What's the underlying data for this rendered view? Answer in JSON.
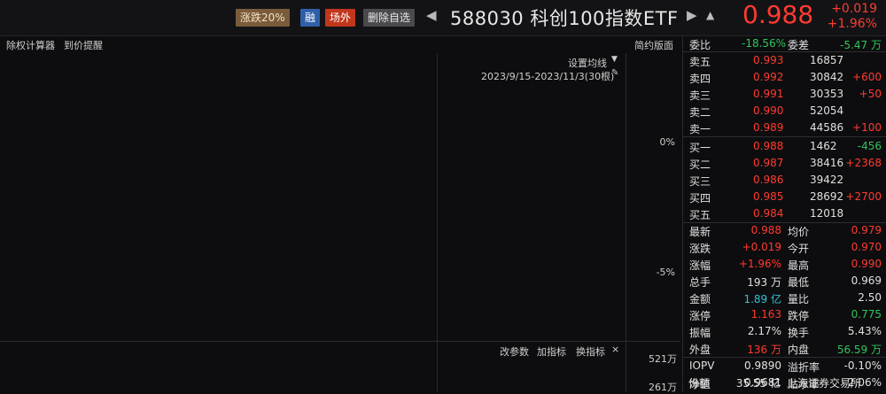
{
  "header": {
    "tags": [
      "涨跌20%",
      "融",
      "场外",
      "删除自选"
    ],
    "nav_left": "◀",
    "title": "588030 科创100指数ETF",
    "nav_right": "▶",
    "bell": "▲",
    "price": "0.988",
    "change": "+0.019",
    "change_pct": "+1.96%"
  },
  "toolbar": {
    "calc": "除权计算器",
    "alert": "到价提醒",
    "simple": "简约版面"
  },
  "chart": {
    "ma_setting": "设置均线",
    "range": "2023/9/15-2023/11/3(30根)",
    "pct0": "0%",
    "pct_neg5": "-5%",
    "change_param": "改参数",
    "add_ind": "加指标",
    "swap_ind": "换指标",
    "close": "×",
    "vol1": "521万",
    "vol2": "261万"
  },
  "quote": {
    "ratio": {
      "label": "委比",
      "value": "-18.56%",
      "diff_label": "委差",
      "diff": "-5.47 万"
    },
    "asks": [
      {
        "label": "卖五",
        "price": "0.993",
        "vol": "16857",
        "delta": ""
      },
      {
        "label": "卖四",
        "price": "0.992",
        "vol": "30842",
        "delta": "+600"
      },
      {
        "label": "卖三",
        "price": "0.991",
        "vol": "30353",
        "delta": "+50"
      },
      {
        "label": "卖二",
        "price": "0.990",
        "vol": "52054",
        "delta": ""
      },
      {
        "label": "卖一",
        "price": "0.989",
        "vol": "44586",
        "delta": "+100"
      }
    ],
    "bids": [
      {
        "label": "买一",
        "price": "0.988",
        "vol": "1462",
        "delta": "-456"
      },
      {
        "label": "买二",
        "price": "0.987",
        "vol": "38416",
        "delta": "+2368"
      },
      {
        "label": "买三",
        "price": "0.986",
        "vol": "39422",
        "delta": ""
      },
      {
        "label": "买四",
        "price": "0.985",
        "vol": "28692",
        "delta": "+2700"
      },
      {
        "label": "买五",
        "price": "0.984",
        "vol": "12018",
        "delta": ""
      }
    ],
    "stats": [
      {
        "l1": "最新",
        "v1": "0.988",
        "l2": "均价",
        "v2": "0.979"
      },
      {
        "l1": "涨跌",
        "v1": "+0.019",
        "l2": "今开",
        "v2": "0.970"
      },
      {
        "l1": "涨幅",
        "v1": "+1.96%",
        "l2": "最高",
        "v2": "0.990"
      },
      {
        "l1": "总手",
        "v1": "193 万",
        "l2": "最低",
        "v2": "0.969"
      },
      {
        "l1": "金额",
        "v1": "1.89 亿",
        "l2": "量比",
        "v2": "2.50"
      },
      {
        "l1": "涨停",
        "v1": "1.163",
        "l2": "跌停",
        "v2": "0.775"
      },
      {
        "l1": "振幅",
        "v1": "2.17%",
        "l2": "换手",
        "v2": "5.43%"
      },
      {
        "l1": "外盘",
        "v1": "136 万",
        "l2": "内盘",
        "v2": "56.59 万"
      },
      {
        "l1": "IOPV",
        "v1": "0.9890",
        "l2": "溢折率",
        "v2": "-0.10%"
      },
      {
        "l1": "净值",
        "v1": "0.9681",
        "l2": "贴水率",
        "v2": "2.06%"
      },
      {
        "l1": "份额",
        "v1": "35.55 亿",
        "l2": "上海证券交易所",
        "v2": ""
      }
    ]
  }
}
